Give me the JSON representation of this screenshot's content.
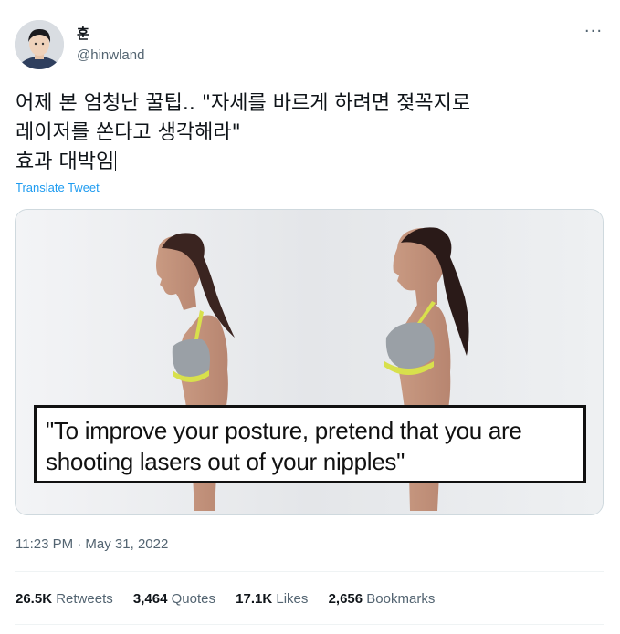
{
  "author": {
    "display_name": "훈",
    "handle": "@hinwland"
  },
  "menu": {
    "more_icon": "more-horizontal-icon",
    "more_label": "···"
  },
  "tweet": {
    "lines": [
      "어제 본 엄청난 꿀팁.. \"자세를 바르게 하려면 젖꼭지로",
      "레이저를 쏜다고 생각해라\"",
      "효과 대박임"
    ],
    "translate_label": "Translate Tweet",
    "timestamp": "11:23 PM · May 31, 2022"
  },
  "media": {
    "caption_lines": [
      "\"To improve your posture, pretend that you are",
      "shooting lasers out of your nipples\""
    ]
  },
  "stats": {
    "retweets_count": "26.5K",
    "retweets_label": "Retweets",
    "quotes_count": "3,464",
    "quotes_label": "Quotes",
    "likes_count": "17.1K",
    "likes_label": "Likes",
    "bookmarks_count": "2,656",
    "bookmarks_label": "Bookmarks"
  },
  "colors": {
    "text": "#0f1419",
    "secondary": "#536471",
    "link": "#1d9bf0",
    "divider": "#eff3f4"
  }
}
